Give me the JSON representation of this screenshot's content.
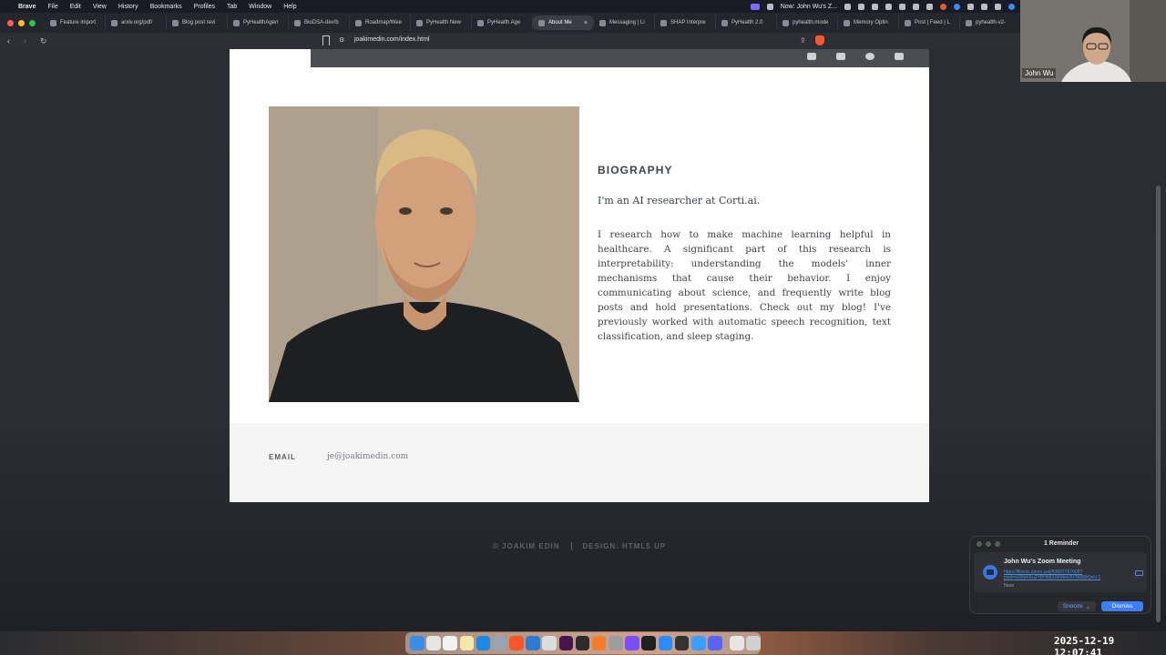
{
  "menubar": {
    "app": "Brave",
    "items": [
      "File",
      "Edit",
      "View",
      "History",
      "Bookmarks",
      "Profiles",
      "Tab",
      "Window",
      "Help"
    ],
    "now_playing": "Now: John Wu's Z..."
  },
  "tabs": [
    {
      "label": "Feature import",
      "active": false
    },
    {
      "label": "arxiv.org/pdf/",
      "active": false
    },
    {
      "label": "Blog post revi",
      "active": false
    },
    {
      "label": "PyHealthAgen",
      "active": false
    },
    {
      "label": "BioDSA-dev/b",
      "active": false
    },
    {
      "label": "Roadmap/Wee",
      "active": false
    },
    {
      "label": "PyHealth New",
      "active": false
    },
    {
      "label": "PyHealth Age",
      "active": false
    },
    {
      "label": "About Me",
      "active": true
    },
    {
      "label": "Messaging | Li",
      "active": false
    },
    {
      "label": "SHAP Interpre",
      "active": false
    },
    {
      "label": "PyHealth 2.0",
      "active": false
    },
    {
      "label": "pyhealth.mode",
      "active": false
    },
    {
      "label": "Memory Optin",
      "active": false
    },
    {
      "label": "Post | Feed | L",
      "active": false
    },
    {
      "label": "pyhealth-v2-",
      "active": false
    }
  ],
  "address": {
    "url": "joakimedin.com/index.html"
  },
  "page": {
    "bio_title": "BIOGRAPHY",
    "intro": "I'm an AI researcher at Corti.ai.",
    "paragraph": "I research how to make machine learning helpful in healthcare. A significant part of this research is interpretability: understanding the models' inner mechanisms that cause their behavior. I enjoy communicating about science, and frequently write blog posts and hold presentations. Check out my blog! I've previously worked with automatic speech recognition, text classification, and sleep staging.",
    "email_label": "EMAIL",
    "email_value": "je@joakimedin.com",
    "copyright": "© JOAKIM EDIN",
    "design_credit": "DESIGN: HTML5 UP"
  },
  "zoom": {
    "participant": "John Wu"
  },
  "reminder": {
    "header": "1 Reminder",
    "title": "John Wu's Zoom Meeting",
    "link": "https://illinois.zoom.us/j/83697767005?pwd=eXKbKKu2YBHfd0UMWeU6YN6BBQoU.1",
    "time": "Now",
    "snooze_label": "Snooze",
    "dismiss_label": "Dismiss"
  },
  "clock": "2025-12-19 12:07:41",
  "colors": {
    "accent": "#3d7ef5",
    "page_bg": "#2a2e33",
    "text": "#3f4448"
  }
}
